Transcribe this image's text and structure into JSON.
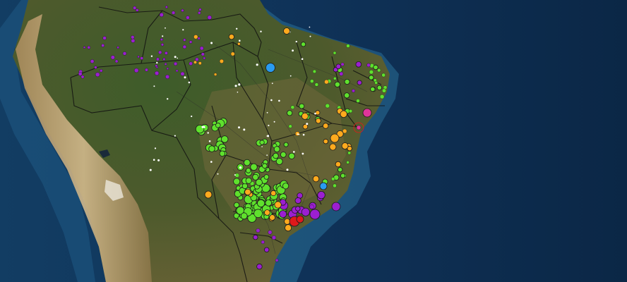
{
  "map": {
    "colors": {
      "ocean_deep": "#0d2a4c",
      "ocean_shelf": "#2f7fa8",
      "forest": "#3c5a2a",
      "savanna": "#7a6d3e",
      "andes": "#b79a6a",
      "border": "#111111",
      "green": "#5fe12d",
      "orange": "#ffaa1e",
      "purple": "#9b1fd0",
      "blue": "#2a9bf0",
      "magenta": "#e0359a",
      "red": "#e01a1a",
      "white": "#ffffff"
    },
    "layers": [
      {
        "name": "green",
        "count": 160
      },
      {
        "name": "orange",
        "count": 40
      },
      {
        "name": "purple",
        "count": 90
      },
      {
        "name": "blue",
        "count": 3
      },
      {
        "name": "red",
        "count": 3
      }
    ]
  }
}
